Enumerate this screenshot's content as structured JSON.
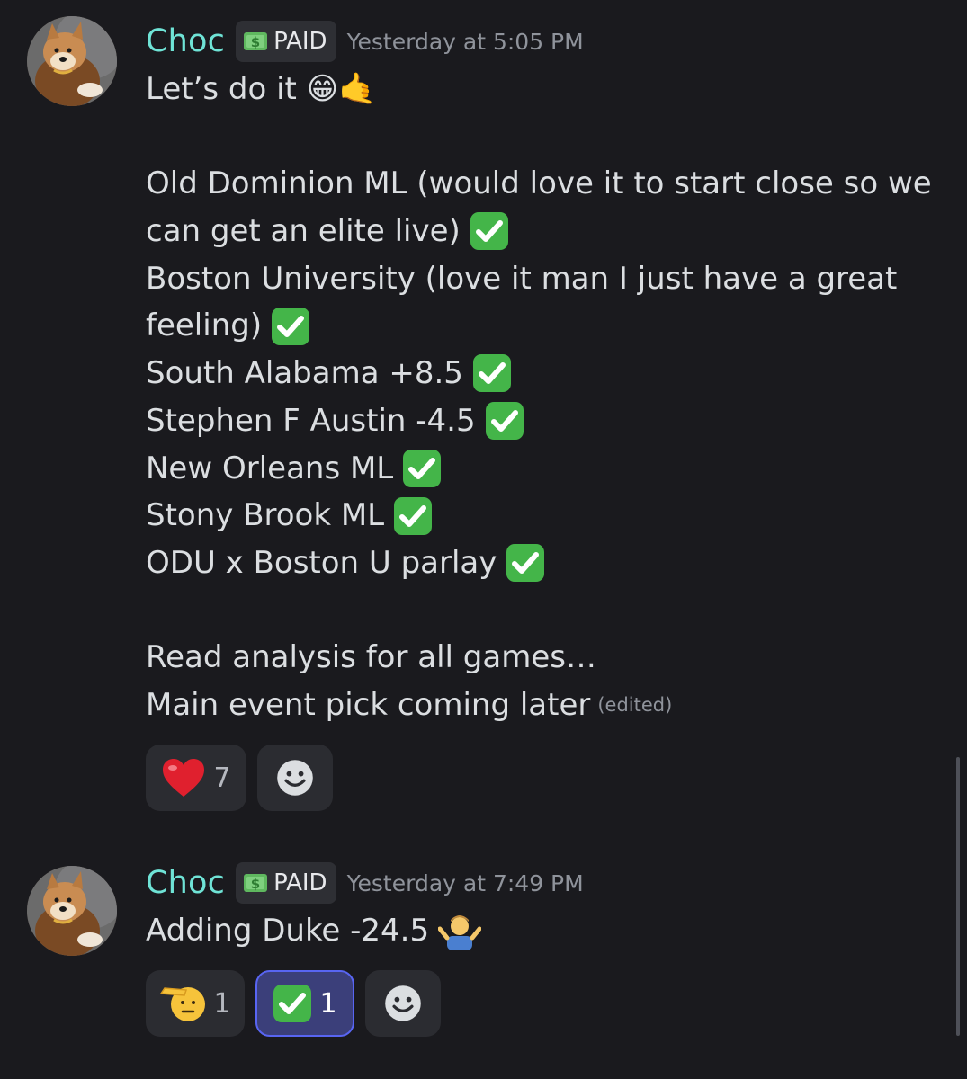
{
  "messages": [
    {
      "username": "Choc",
      "role_badge": "PAID",
      "timestamp": "Yesterday at 5:05 PM",
      "lines": [
        "Let’s do it 😁🤙",
        "",
        "Old Dominion ML (would love it to start close so we",
        "can get an elite live)",
        "Boston University (love it man I just have a great",
        "feeling)",
        "South Alabama +8.5",
        "Stephen F Austin -4.5",
        "New Orleans ML",
        "Stony Brook ML",
        "ODU x Boston U parlay",
        "",
        "Read analysis for all games…",
        "Main event pick coming later"
      ],
      "edited_label": "(edited)",
      "reactions": [
        {
          "emoji": "heart-emoji",
          "count": "7"
        },
        {
          "emoji": "add-reaction-icon",
          "count": ""
        }
      ]
    },
    {
      "username": "Choc",
      "role_badge": "PAID",
      "timestamp": "Yesterday at 7:49 PM",
      "lines": [
        "Adding Duke -24.5"
      ],
      "reactions": [
        {
          "emoji": "saluting-face-emoji",
          "count": "1"
        },
        {
          "emoji": "check-mark-button-emoji",
          "count": "1",
          "active": true
        },
        {
          "emoji": "add-reaction-icon",
          "count": ""
        }
      ]
    }
  ],
  "colors": {
    "background": "#1a1a1e",
    "username": "#6fe3d6",
    "text": "#dbdee1",
    "muted": "#8f939b",
    "reaction_bg": "#2b2c31",
    "reaction_active_bg": "#3b3f7a",
    "reaction_active_border": "#5865f2",
    "check_green": "#3aa55c"
  }
}
